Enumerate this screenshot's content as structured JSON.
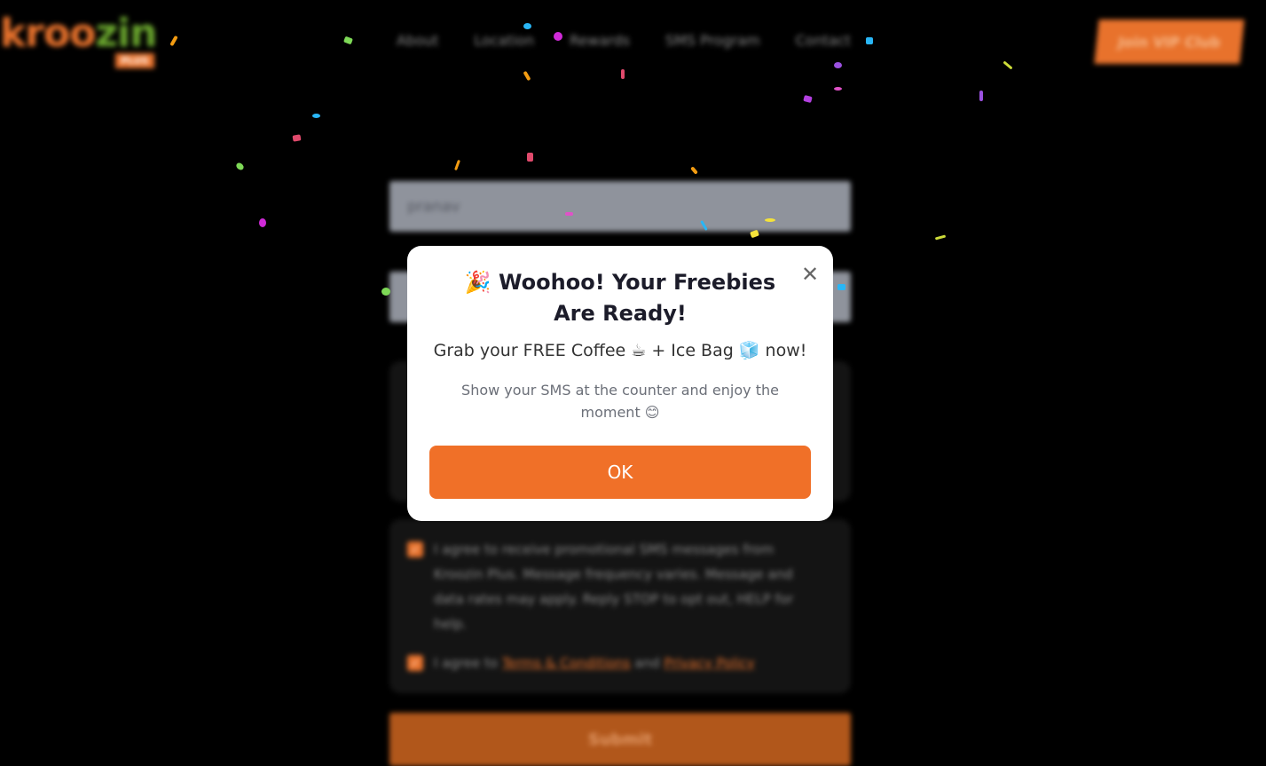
{
  "header": {
    "logo_text_orange": "kroo",
    "logo_text_green": "zin",
    "logo_badge": "PLUS",
    "nav": [
      "About",
      "Location",
      "Rewards",
      "SMS Program",
      "Contact"
    ],
    "cta_label": "Join VIP Club"
  },
  "form": {
    "name_value": "pranav",
    "consent_sms": "I agree to receive promotional SMS messages from Kroozin Plus. Message frequency varies. Message and data rates may apply. Reply STOP to opt out, HELP for help.",
    "consent_terms_prefix": "I agree to",
    "terms_link": "Terms & Conditions",
    "consent_and": "and",
    "privacy_link": "Privacy Policy",
    "submit_label": "Submit"
  },
  "modal": {
    "title": "🎉 Woohoo! Your Freebies Are Ready!",
    "subtitle": "Grab your FREE Coffee ☕ + Ice Bag 🧊 now!",
    "note": "Show your SMS at the counter and enjoy the moment 😊",
    "ok_label": "OK",
    "close_glyph": "✕"
  },
  "colors": {
    "accent": "#f07028",
    "brand_green": "#6aa62e",
    "backdrop": "#000000"
  }
}
